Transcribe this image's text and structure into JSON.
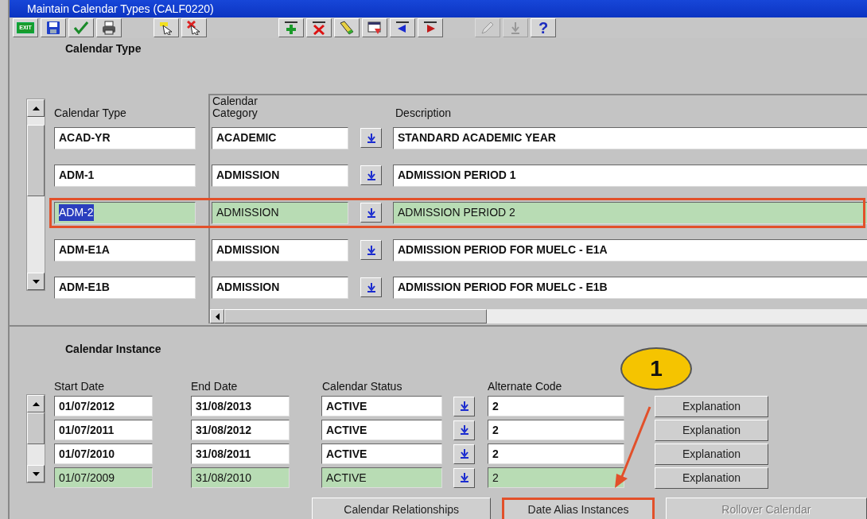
{
  "window": {
    "title": "Maintain Calendar Types (CALF0220)"
  },
  "toolbar": [
    [
      {
        "kind": "exit",
        "label": "EXIT",
        "disabled": false
      },
      {
        "kind": "save",
        "disabled": false
      },
      {
        "kind": "accept",
        "disabled": false
      },
      {
        "kind": "print",
        "disabled": false
      }
    ],
    [
      {
        "kind": "enter_query",
        "disabled": false
      },
      {
        "kind": "cancel_query",
        "disabled": false
      }
    ],
    [
      {
        "kind": "insert",
        "disabled": false
      },
      {
        "kind": "delete",
        "disabled": false
      },
      {
        "kind": "clear",
        "disabled": false
      },
      {
        "kind": "duplicate",
        "disabled": false
      },
      {
        "kind": "previous",
        "disabled": false
      },
      {
        "kind": "next",
        "disabled": false
      }
    ],
    [
      {
        "kind": "edit",
        "disabled": true
      },
      {
        "kind": "download",
        "disabled": true
      },
      {
        "kind": "help",
        "label": "?",
        "disabled": false
      }
    ]
  ],
  "calendar_type": {
    "title": "Calendar Type",
    "columns": [
      "Calendar Type",
      "Calendar Category",
      "Description"
    ],
    "rows": [
      {
        "code": "ACAD-YR",
        "category": "ACADEMIC",
        "description": "STANDARD ACADEMIC YEAR",
        "selected": false
      },
      {
        "code": "ADM-1",
        "category": "ADMISSION",
        "description": "ADMISSION PERIOD 1",
        "selected": false
      },
      {
        "code": "ADM-2",
        "category": "ADMISSION",
        "description": "ADMISSION PERIOD 2",
        "selected": true
      },
      {
        "code": "ADM-E1A",
        "category": "ADMISSION",
        "description": "ADMISSION PERIOD FOR  MUELC - E1A",
        "selected": false
      },
      {
        "code": "ADM-E1B",
        "category": "ADMISSION",
        "description": "ADMISSION PERIOD FOR  MUELC - E1B",
        "selected": false
      }
    ]
  },
  "calendar_instance": {
    "title": "Calendar Instance",
    "columns": [
      "Start Date",
      "End Date",
      "Calendar Status",
      "Alternate Code"
    ],
    "rows": [
      {
        "start_date": "01/07/2012",
        "end_date": "31/08/2013",
        "status": "ACTIVE",
        "alternate_code": "2",
        "button": "Explanation",
        "selected": false
      },
      {
        "start_date": "01/07/2011",
        "end_date": "31/08/2012",
        "status": "ACTIVE",
        "alternate_code": "2",
        "button": "Explanation",
        "selected": false
      },
      {
        "start_date": "01/07/2010",
        "end_date": "31/08/2011",
        "status": "ACTIVE",
        "alternate_code": "2",
        "button": "Explanation",
        "selected": false
      },
      {
        "start_date": "01/07/2009",
        "end_date": "31/08/2010",
        "status": "ACTIVE",
        "alternate_code": "2",
        "button": "Explanation",
        "selected": true
      }
    ],
    "buttons": [
      {
        "label": "Calendar Relationships",
        "disabled": false,
        "outlined": false
      },
      {
        "label": "Date Alias Instances",
        "disabled": false,
        "outlined": true
      },
      {
        "label": "Rollover Calendar",
        "disabled": true,
        "outlined": false
      }
    ]
  },
  "callout": {
    "label": "1"
  }
}
